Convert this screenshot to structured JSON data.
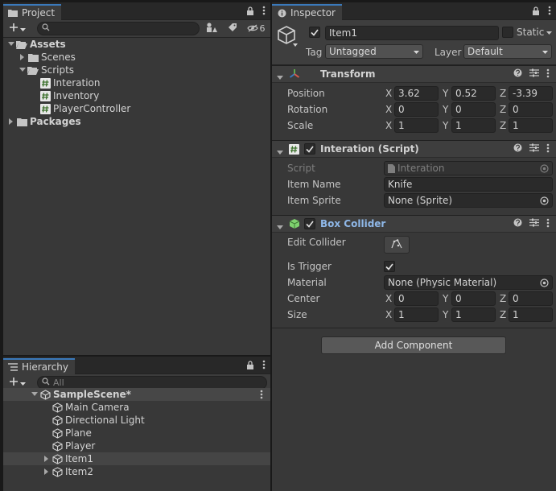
{
  "project": {
    "tab_label": "Project",
    "search_value": "",
    "hidden_count": "6",
    "tree": [
      {
        "label": "Assets",
        "bold": true
      },
      {
        "label": "Scenes"
      },
      {
        "label": "Scripts"
      },
      {
        "label": "Interation"
      },
      {
        "label": "Inventory"
      },
      {
        "label": "PlayerController"
      },
      {
        "label": "Packages",
        "bold": true
      }
    ]
  },
  "hierarchy": {
    "tab_label": "Hierarchy",
    "search_placeholder": "All",
    "scene_name": "SampleScene*",
    "items": [
      {
        "label": "Main Camera"
      },
      {
        "label": "Directional Light"
      },
      {
        "label": "Plane"
      },
      {
        "label": "Player"
      },
      {
        "label": "Item1",
        "selected": true
      },
      {
        "label": "Item2"
      }
    ]
  },
  "inspector": {
    "tab_label": "Inspector",
    "object_name": "Item1",
    "static_label": "Static",
    "tag_label": "Tag",
    "tag_value": "Untagged",
    "layer_label": "Layer",
    "layer_value": "Default",
    "transform": {
      "title": "Transform",
      "position_label": "Position",
      "rotation_label": "Rotation",
      "scale_label": "Scale",
      "position": {
        "x": "3.62",
        "y": "0.52",
        "z": "-3.39"
      },
      "rotation": {
        "x": "0",
        "y": "0",
        "z": "0"
      },
      "scale": {
        "x": "1",
        "y": "1",
        "z": "1"
      }
    },
    "script_component": {
      "title": "Interation (Script)",
      "script_label": "Script",
      "script_value": "Interation",
      "item_name_label": "Item Name",
      "item_name_value": "Knife",
      "item_sprite_label": "Item Sprite",
      "item_sprite_value": "None (Sprite)"
    },
    "box_collider": {
      "title": "Box Collider",
      "edit_collider_label": "Edit Collider",
      "is_trigger_label": "Is Trigger",
      "material_label": "Material",
      "material_value": "None (Physic Material)",
      "center_label": "Center",
      "size_label": "Size",
      "center": {
        "x": "0",
        "y": "0",
        "z": "0"
      },
      "size": {
        "x": "1",
        "y": "1",
        "z": "1"
      }
    },
    "add_component_label": "Add Component"
  },
  "axis_labels": {
    "x": "X",
    "y": "Y",
    "z": "Z"
  },
  "colors": {
    "accent": "#3a79bb",
    "collider_title": "#8fb8e8",
    "script_icon": "#6aa84f",
    "cube_icon": "#7fd16f"
  }
}
